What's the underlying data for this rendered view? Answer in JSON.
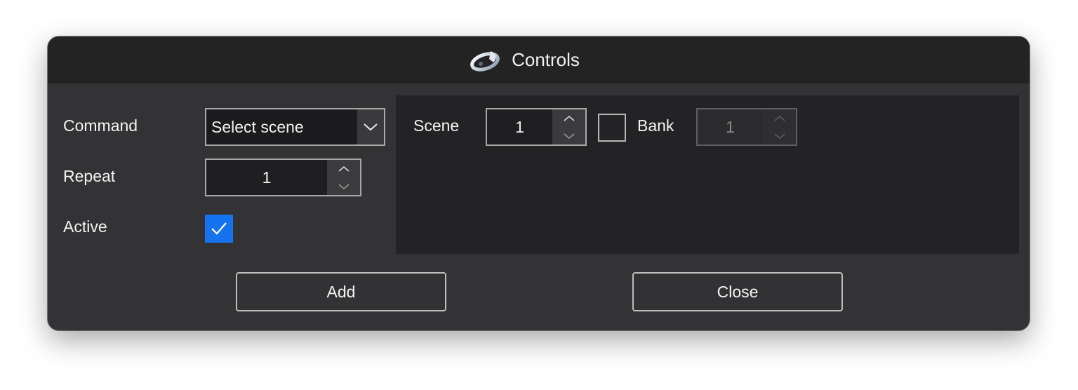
{
  "window": {
    "title": "Controls"
  },
  "form": {
    "command_label": "Command",
    "command_value": "Select scene",
    "repeat_label": "Repeat",
    "repeat_value": "1",
    "active_label": "Active",
    "active_checked": true
  },
  "params": {
    "scene_label": "Scene",
    "scene_value": "1",
    "bank_label": "Bank",
    "bank_enabled": false,
    "bank_value": "1"
  },
  "actions": {
    "add_label": "Add",
    "close_label": "Close"
  },
  "colors": {
    "accent": "#1673f0",
    "window_bg": "#333335",
    "titlebar_bg": "#232324"
  },
  "icons": {
    "app": "app-logo-icon",
    "dropdown": "chevron-down-icon",
    "spin_up": "chevron-up-icon",
    "spin_down": "chevron-down-icon",
    "check": "checkmark-icon"
  }
}
